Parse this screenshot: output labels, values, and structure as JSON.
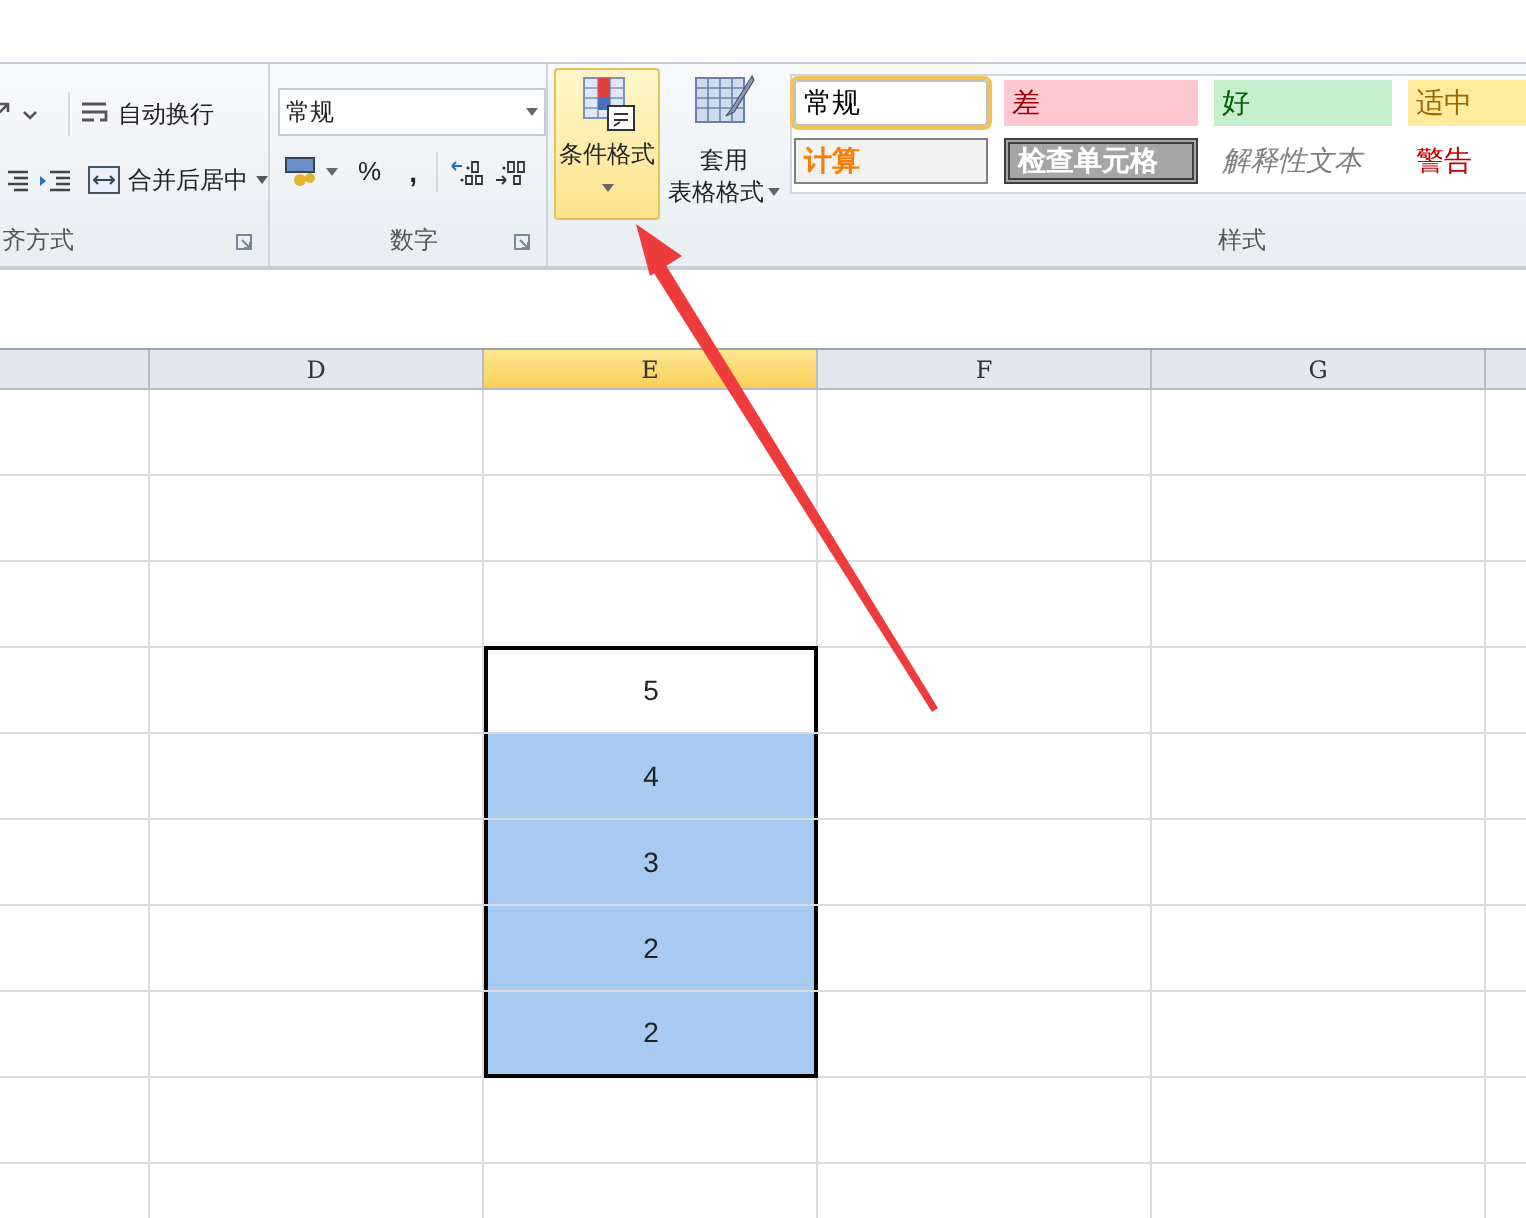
{
  "ribbon": {
    "alignment_group": {
      "label": "齐方式",
      "wrap_text": "自动换行",
      "merge_center": "合并后居中"
    },
    "number_group": {
      "label": "数字",
      "format": "常规",
      "percent": "%",
      "comma": ","
    },
    "styles_group": {
      "label": "样式",
      "conditional_format": {
        "label": "条件格式",
        "highlighted": true
      },
      "table_format": {
        "line_1": "套用",
        "line_2": "表格格式"
      },
      "styles": [
        {
          "label": "常规",
          "kind": "normal",
          "selected": true
        },
        {
          "label": "差",
          "kind": "bad",
          "selected": false
        },
        {
          "label": "好",
          "kind": "good",
          "selected": false
        },
        {
          "label": "适中",
          "kind": "neutral",
          "selected": false
        },
        {
          "label": "计算",
          "kind": "calculation",
          "selected": false
        },
        {
          "label": "检查单元格",
          "kind": "check",
          "selected": false
        },
        {
          "label": "解释性文本",
          "kind": "explanatory",
          "selected": false
        },
        {
          "label": "警告",
          "kind": "warning",
          "selected": false
        }
      ]
    }
  },
  "sheet": {
    "columns": [
      {
        "label": "D",
        "selected": false
      },
      {
        "label": "E",
        "selected": true
      },
      {
        "label": "F",
        "selected": false
      },
      {
        "label": "G",
        "selected": false
      }
    ],
    "values": [
      {
        "value": "5",
        "selected": false
      },
      {
        "value": "4",
        "selected": true
      },
      {
        "value": "3",
        "selected": true
      },
      {
        "value": "2",
        "selected": true
      },
      {
        "value": "2",
        "selected": true
      }
    ]
  }
}
